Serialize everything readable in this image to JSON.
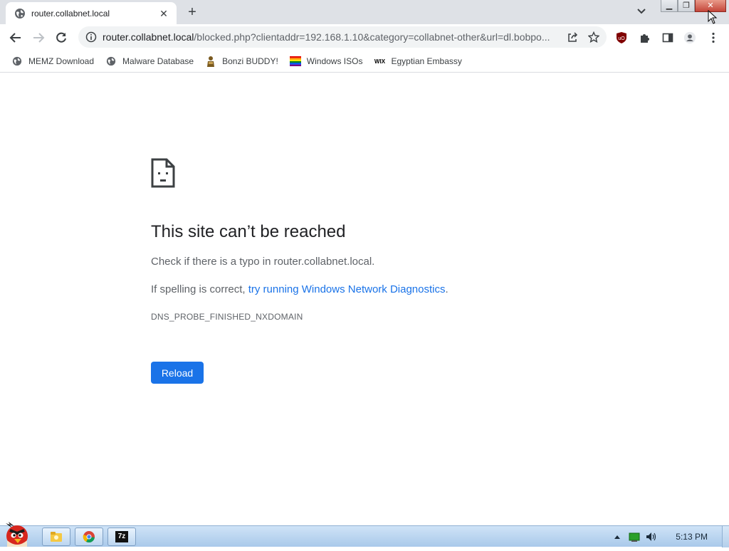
{
  "browser": {
    "tab": {
      "title": "router.collabnet.local",
      "favicon": "globe-icon"
    },
    "omnibox": {
      "url_host": "router.collabnet.local",
      "url_rest": "/blocked.php?clientaddr=192.168.1.10&category=collabnet-other&url=dl.bobpo..."
    },
    "bookmarks": [
      {
        "label": "MEMZ Download",
        "icon": "globe-icon"
      },
      {
        "label": "Malware Database",
        "icon": "globe-icon"
      },
      {
        "label": "Bonzi BUDDY!",
        "icon": "bonzi-icon"
      },
      {
        "label": "Windows ISOs",
        "icon": "rainbow-flag-icon"
      },
      {
        "label": "Egyptian Embassy",
        "icon": "wix-icon"
      }
    ],
    "wix_logo_text": "WIX"
  },
  "error_page": {
    "title": "This site can’t be reached",
    "line1": "Check if there is a typo in router.collabnet.local.",
    "line2_prefix": "If spelling is correct, ",
    "line2_link": "try running Windows Network Diagnostics",
    "line2_suffix": ".",
    "error_code": "DNS_PROBE_FINISHED_NXDOMAIN",
    "reload_label": "Reload"
  },
  "taskbar": {
    "clock": "5:13 PM",
    "apps": [
      "explorer-icon",
      "chrome-icon",
      "7zip-icon"
    ],
    "seven_zip_label": "7z"
  },
  "colors": {
    "accent": "#1a73e8",
    "tabstrip": "#dee1e6",
    "omnibox": "#f1f3f4"
  }
}
